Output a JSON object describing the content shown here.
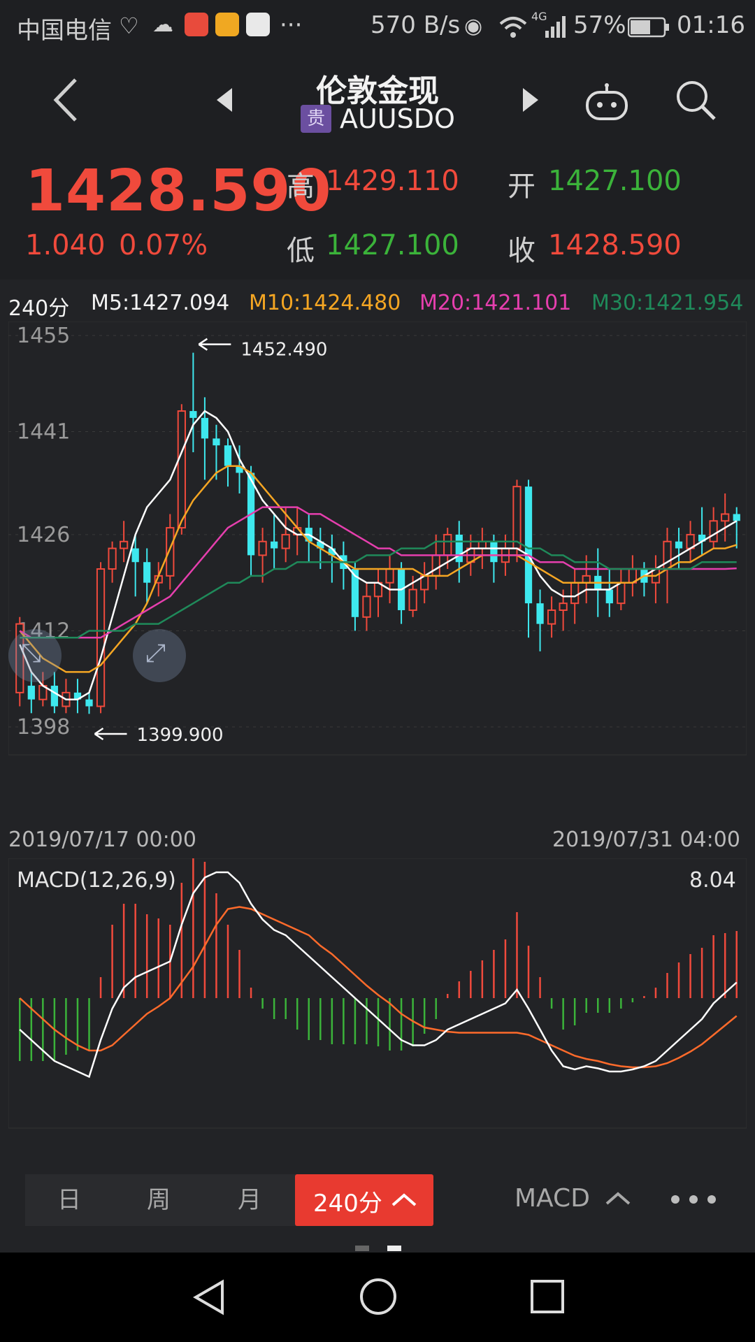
{
  "status_bar": {
    "carrier": "中国电信",
    "speed": "570 B/s",
    "network": "4G",
    "battery": "57%",
    "time": "01:16"
  },
  "nav": {
    "title": "伦敦金现",
    "badge": "贵",
    "symbol": "AUUSDO"
  },
  "quote": {
    "price": "1428.590",
    "change": "1.040",
    "change_pct": "0.07%",
    "high_label": "高",
    "high": "1429.110",
    "low_label": "低",
    "low": "1427.100",
    "open_label": "开",
    "open": "1427.100",
    "close_label": "收",
    "close": "1428.590"
  },
  "ma_legend": {
    "period": "240分",
    "m5": "M5:1427.094",
    "m10": "M10:1424.480",
    "m20": "M20:1421.101",
    "m30": "M30:1421.954"
  },
  "chart_data": [
    {
      "type": "candlestick",
      "y_ticks": [
        "1455",
        "1441",
        "1426",
        "1412",
        "1398"
      ],
      "ylim": [
        1398,
        1455
      ],
      "max_annotation": "1452.490",
      "min_annotation": "1399.900",
      "x_start": "2019/07/17 00:00",
      "x_end": "2019/07/31 04:00",
      "candles": [
        [
          1403,
          1413,
          1401,
          1414
        ],
        [
          1404,
          1402,
          1400,
          1406
        ],
        [
          1402,
          1404,
          1401,
          1406
        ],
        [
          1404,
          1401,
          1400,
          1406
        ],
        [
          1401,
          1403,
          1400,
          1405
        ],
        [
          1403,
          1402,
          1400,
          1405
        ],
        [
          1402,
          1401,
          1399.9,
          1403
        ],
        [
          1401,
          1421,
          1400,
          1422
        ],
        [
          1421,
          1424,
          1419,
          1425
        ],
        [
          1424,
          1425,
          1422,
          1428
        ],
        [
          1424,
          1422,
          1417,
          1426
        ],
        [
          1422,
          1419,
          1416,
          1424
        ],
        [
          1419,
          1420,
          1417,
          1422
        ],
        [
          1420,
          1427,
          1418,
          1429
        ],
        [
          1427,
          1444,
          1426,
          1445
        ],
        [
          1444,
          1443,
          1438,
          1452.49
        ],
        [
          1443,
          1440,
          1434,
          1446
        ],
        [
          1440,
          1439,
          1434,
          1442
        ],
        [
          1439,
          1436,
          1433,
          1440
        ],
        [
          1436,
          1435,
          1432,
          1439
        ],
        [
          1435,
          1423,
          1420,
          1436
        ],
        [
          1423,
          1425,
          1419,
          1427
        ],
        [
          1425,
          1424,
          1421,
          1429
        ],
        [
          1424,
          1426,
          1422,
          1430
        ],
        [
          1426,
          1427,
          1423,
          1430
        ],
        [
          1427,
          1425,
          1422,
          1429
        ],
        [
          1425,
          1424,
          1421,
          1427
        ],
        [
          1424,
          1423,
          1419,
          1426
        ],
        [
          1423,
          1421,
          1418,
          1425
        ],
        [
          1421,
          1414,
          1412,
          1422
        ],
        [
          1414,
          1417,
          1412,
          1419
        ],
        [
          1417,
          1419,
          1414,
          1421
        ],
        [
          1419,
          1421,
          1416,
          1423
        ],
        [
          1421,
          1415,
          1413,
          1422
        ],
        [
          1415,
          1418,
          1414,
          1420
        ],
        [
          1418,
          1420,
          1416,
          1422
        ],
        [
          1420,
          1423,
          1418,
          1426
        ],
        [
          1423,
          1426,
          1421,
          1427
        ],
        [
          1426,
          1422,
          1419,
          1428
        ],
        [
          1422,
          1424,
          1420,
          1426
        ],
        [
          1424,
          1425,
          1421,
          1427
        ],
        [
          1425,
          1422,
          1419,
          1426
        ],
        [
          1422,
          1424,
          1420,
          1426
        ],
        [
          1424,
          1433,
          1422,
          1434
        ],
        [
          1433,
          1416,
          1411,
          1434
        ],
        [
          1416,
          1413,
          1409,
          1418
        ],
        [
          1413,
          1415,
          1411,
          1417
        ],
        [
          1415,
          1416,
          1412,
          1418
        ],
        [
          1416,
          1419,
          1413,
          1421
        ],
        [
          1419,
          1420,
          1416,
          1423
        ],
        [
          1420,
          1418,
          1414,
          1424
        ],
        [
          1418,
          1416,
          1414,
          1421
        ],
        [
          1416,
          1419,
          1415,
          1421
        ],
        [
          1419,
          1421,
          1417,
          1423
        ],
        [
          1421,
          1419,
          1417,
          1422
        ],
        [
          1419,
          1421,
          1416,
          1423
        ],
        [
          1421,
          1425,
          1416,
          1427
        ],
        [
          1425,
          1424,
          1421,
          1427
        ],
        [
          1424,
          1426,
          1422,
          1428
        ],
        [
          1426,
          1425,
          1423,
          1430
        ],
        [
          1425,
          1428,
          1424,
          1430
        ],
        [
          1428,
          1429,
          1425,
          1432
        ],
        [
          1429,
          1428,
          1424,
          1430
        ]
      ],
      "ma": [
        {
          "name": "M5",
          "color": "#ffffff",
          "values": [
            1410,
            1406,
            1404,
            1403,
            1402,
            1402,
            1403,
            1408,
            1414,
            1420,
            1426,
            1430,
            1432,
            1434,
            1438,
            1442,
            1444,
            1443,
            1441,
            1437,
            1434,
            1431,
            1429,
            1427,
            1426,
            1426,
            1425,
            1424,
            1422,
            1420,
            1419,
            1419,
            1418,
            1418,
            1419,
            1420,
            1421,
            1422,
            1423,
            1424,
            1424,
            1424,
            1424,
            1424,
            1423,
            1420,
            1418,
            1417,
            1417,
            1418,
            1418,
            1418,
            1419,
            1419,
            1420,
            1421,
            1422,
            1423,
            1424,
            1425,
            1426,
            1427,
            1428
          ]
        },
        {
          "name": "M10",
          "color": "#f5a623",
          "values": [
            1412,
            1410,
            1408,
            1407,
            1406,
            1406,
            1406,
            1407,
            1409,
            1411,
            1413,
            1416,
            1420,
            1424,
            1428,
            1431,
            1433,
            1435,
            1436,
            1436,
            1435,
            1433,
            1431,
            1429,
            1427,
            1425,
            1424,
            1423,
            1422,
            1421,
            1421,
            1421,
            1421,
            1421,
            1421,
            1420,
            1420,
            1420,
            1421,
            1422,
            1423,
            1423,
            1423,
            1423,
            1422,
            1421,
            1420,
            1419,
            1419,
            1419,
            1419,
            1419,
            1419,
            1419,
            1420,
            1420,
            1421,
            1422,
            1422,
            1423,
            1424,
            1424,
            1424.5
          ]
        },
        {
          "name": "M20",
          "color": "#e63fae",
          "values": [
            1412,
            1411,
            1411,
            1411,
            1411,
            1411,
            1411,
            1411,
            1412,
            1413,
            1414,
            1415,
            1416,
            1417,
            1419,
            1421,
            1423,
            1425,
            1427,
            1428,
            1429,
            1430,
            1430,
            1430,
            1430,
            1429,
            1429,
            1428,
            1427,
            1426,
            1425,
            1424,
            1424,
            1423,
            1423,
            1423,
            1423,
            1423,
            1423,
            1423,
            1423,
            1423,
            1423,
            1423,
            1423,
            1422,
            1422,
            1422,
            1421,
            1421,
            1421,
            1421,
            1421,
            1421,
            1421,
            1421,
            1421,
            1421,
            1421,
            1421,
            1421,
            1421,
            1421.1
          ]
        },
        {
          "name": "M30",
          "color": "#1f8a5a",
          "values": [
            1411,
            1411,
            1411,
            1411,
            1411,
            1411,
            1412,
            1412,
            1412,
            1412,
            1413,
            1413,
            1413,
            1414,
            1415,
            1416,
            1417,
            1418,
            1419,
            1419,
            1420,
            1420,
            1421,
            1421,
            1422,
            1422,
            1422,
            1422,
            1422,
            1422,
            1423,
            1423,
            1423,
            1424,
            1424,
            1424,
            1425,
            1425,
            1425,
            1425,
            1425,
            1425,
            1425,
            1425,
            1424,
            1424,
            1423,
            1423,
            1422,
            1422,
            1422,
            1421,
            1421,
            1421,
            1421,
            1421,
            1421,
            1421,
            1421,
            1422,
            1422,
            1422,
            1422
          ]
        }
      ]
    },
    {
      "type": "macd",
      "label": "MACD(12,26,9)",
      "value_label": "8.04",
      "ylim": [
        -12,
        12
      ],
      "dif": [
        -3,
        -4,
        -5,
        -6,
        -6.5,
        -7,
        -7.5,
        -4,
        -1,
        1,
        2,
        2.5,
        3,
        3.5,
        7,
        10,
        11.5,
        12,
        12,
        11,
        9,
        7.5,
        6.5,
        6,
        5,
        4,
        3,
        2,
        1,
        0,
        -1,
        -2,
        -3,
        -4,
        -4.5,
        -4.5,
        -4,
        -3,
        -2.5,
        -2,
        -1.5,
        -1,
        -0.5,
        0.8,
        -1,
        -3,
        -5,
        -6.5,
        -6.8,
        -6.5,
        -6.7,
        -7,
        -7,
        -6.8,
        -6.5,
        -6,
        -5,
        -4,
        -3,
        -2,
        -0.5,
        0.5,
        1.5
      ],
      "dea": [
        0,
        -1,
        -2,
        -3,
        -3.8,
        -4.5,
        -5,
        -5,
        -4.5,
        -3.5,
        -2.5,
        -1.5,
        -0.8,
        0,
        1.5,
        3,
        5,
        7,
        8.5,
        8.7,
        8.5,
        8,
        7.5,
        7,
        6.5,
        6,
        5,
        4.2,
        3.2,
        2.2,
        1.2,
        0.3,
        -0.5,
        -1.5,
        -2.2,
        -2.8,
        -3,
        -3.2,
        -3.3,
        -3.3,
        -3.3,
        -3.3,
        -3.3,
        -3.3,
        -3.5,
        -4,
        -4.5,
        -5,
        -5.5,
        -5.8,
        -6,
        -6.3,
        -6.5,
        -6.6,
        -6.6,
        -6.5,
        -6.2,
        -5.7,
        -5.1,
        -4.4,
        -3.5,
        -2.6,
        -1.7
      ],
      "colors": {
        "dif": "#ffffff",
        "dea": "#ff6b2b",
        "up": "#f04a3c",
        "down": "#3bb33a"
      }
    }
  ],
  "toolbar": {
    "tab_day": "日",
    "tab_week": "周",
    "tab_month": "月",
    "tab_240": "240分",
    "indicator": "MACD"
  },
  "colors": {
    "up": "#f04a3c",
    "down": "#3ee8ee",
    "accent": "#e83a30",
    "background": "#1e1f22"
  }
}
